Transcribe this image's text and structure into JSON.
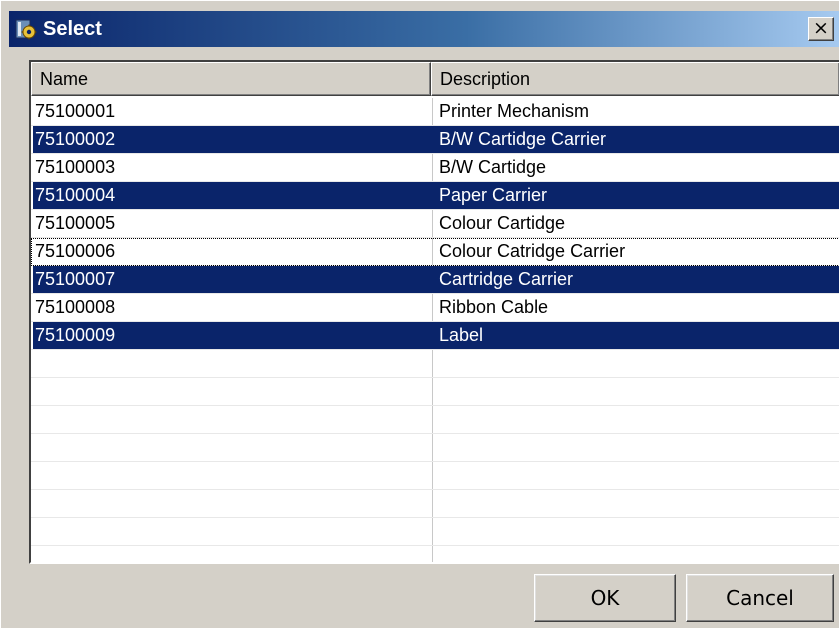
{
  "window": {
    "title": "Select",
    "close_label": "×"
  },
  "list": {
    "columns": [
      "Name",
      "Description"
    ],
    "rows": [
      {
        "name": "75100001",
        "description": "Printer Mechanism",
        "selected": false,
        "focused": false
      },
      {
        "name": "75100002",
        "description": "B/W Cartidge Carrier",
        "selected": true,
        "focused": false
      },
      {
        "name": "75100003",
        "description": "B/W Cartidge",
        "selected": false,
        "focused": false
      },
      {
        "name": "75100004",
        "description": "Paper Carrier",
        "selected": true,
        "focused": false
      },
      {
        "name": "75100005",
        "description": "Colour Cartidge",
        "selected": false,
        "focused": false
      },
      {
        "name": "75100006",
        "description": "Colour Catridge Carrier",
        "selected": false,
        "focused": true
      },
      {
        "name": "75100007",
        "description": "Cartridge Carrier",
        "selected": true,
        "focused": false
      },
      {
        "name": "75100008",
        "description": "Ribbon Cable",
        "selected": false,
        "focused": false
      },
      {
        "name": "75100009",
        "description": "Label",
        "selected": true,
        "focused": false
      }
    ]
  },
  "buttons": {
    "ok": "OK",
    "cancel": "Cancel"
  },
  "colors": {
    "selection": "#0a246a",
    "title_start": "#0a246a",
    "title_end": "#a6caf0",
    "face": "#d4d0c8"
  },
  "icons": {
    "app": "app-gear-icon",
    "close": "close-icon"
  }
}
